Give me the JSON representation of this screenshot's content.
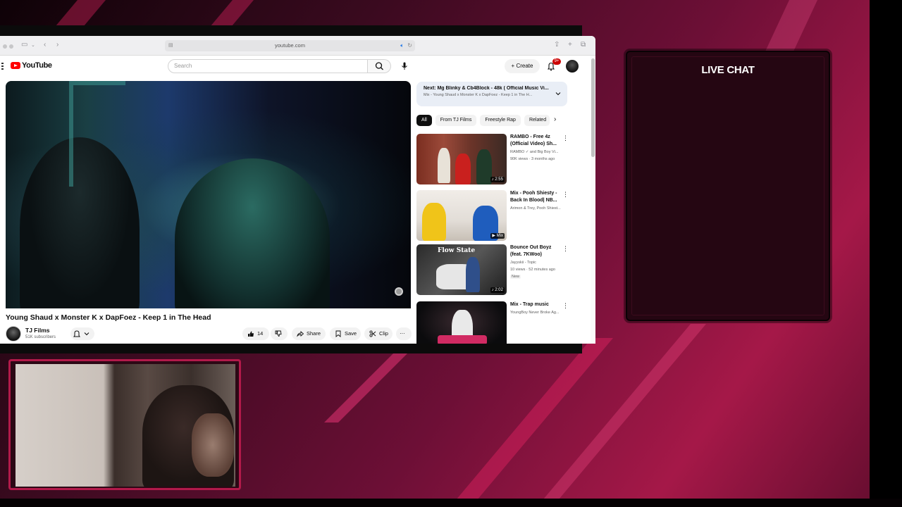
{
  "browser": {
    "url": "youtube.com"
  },
  "youtube": {
    "logo_text": "YouTube",
    "search_placeholder": "Search",
    "create_label": "Create",
    "notification_count": "9+",
    "video_title": "Young Shaud x Monster K x DapFoez - Keep 1 in The Head",
    "channel_name": "TJ Films",
    "channel_subs": "51K subscribers",
    "actions": {
      "like_count": "14",
      "share_label": "Share",
      "save_label": "Save",
      "clip_label": "Clip"
    },
    "next_up": {
      "title": "Next: Mg Blinky & Cb4Block - 48k ( Official Music Vi...",
      "subtitle": "Mix - Young Shaud x Monster K x DapFoez - Keep 1 in The H..."
    },
    "chips": [
      "All",
      "From TJ Films",
      "Freestyle Rap",
      "Related"
    ],
    "recommendations": [
      {
        "title": "RAMBO - Free 4z (Official Video) Sh...",
        "channel": "RAMBO ✓ and Big Boy Vi...",
        "meta": "90K views · 3 months ago",
        "duration": "♪ 2:55",
        "badge": ""
      },
      {
        "title": "Mix - Pooh Shiesty - Back In Blood| NB...",
        "channel": "Arimon & Trey, Pooh Shiest...",
        "meta": "",
        "duration": "▶ Mix",
        "badge": ""
      },
      {
        "title": "Bounce Out Boyz (feat. 7KWoo)",
        "channel": "Jayyskii - Topic",
        "meta": "10 views · 52 minutes ago",
        "duration": "♪ 2:02",
        "badge": "New"
      },
      {
        "title": "Mix - Trap music",
        "channel": "YoungBoy Never Broke Ag...",
        "meta": "",
        "duration": "",
        "badge": ""
      }
    ],
    "thumb_text_3": "Flow State"
  },
  "overlay": {
    "chat_title": "LIVE CHAT"
  },
  "colors": {
    "accent_pink": "#b21a4a",
    "youtube_red": "#ff0000"
  }
}
